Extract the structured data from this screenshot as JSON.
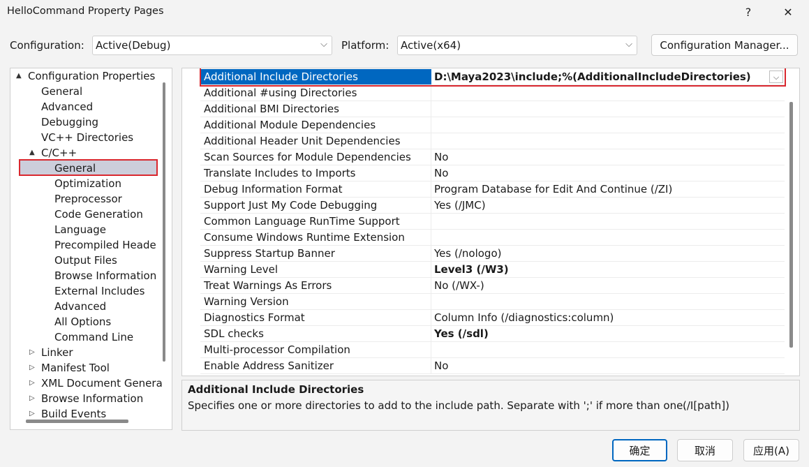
{
  "window": {
    "title": "HelloCommand Property Pages",
    "help_label": "?",
    "close_label": "✕"
  },
  "config_bar": {
    "configuration_label": "Configuration:",
    "configuration_value": "Active(Debug)",
    "platform_label": "Platform:",
    "platform_value": "Active(x64)",
    "config_manager_label": "Configuration Manager..."
  },
  "tree": {
    "items": [
      {
        "label": "Configuration Properties",
        "arrow": "▲"
      },
      {
        "label": "General"
      },
      {
        "label": "Advanced"
      },
      {
        "label": "Debugging"
      },
      {
        "label": "VC++ Directories"
      },
      {
        "label": "C/C++",
        "arrow": "▲"
      },
      {
        "label": "General",
        "selected": true
      },
      {
        "label": "Optimization"
      },
      {
        "label": "Preprocessor"
      },
      {
        "label": "Code Generation"
      },
      {
        "label": "Language"
      },
      {
        "label": "Precompiled Heade"
      },
      {
        "label": "Output Files"
      },
      {
        "label": "Browse Information"
      },
      {
        "label": "External Includes"
      },
      {
        "label": "Advanced"
      },
      {
        "label": "All Options"
      },
      {
        "label": "Command Line"
      },
      {
        "label": "Linker",
        "arrow": "▷"
      },
      {
        "label": "Manifest Tool",
        "arrow": "▷"
      },
      {
        "label": "XML Document Genera",
        "arrow": "▷"
      },
      {
        "label": "Browse Information",
        "arrow": "▷"
      },
      {
        "label": "Build Events",
        "arrow": "▷"
      }
    ]
  },
  "grid": {
    "rows": [
      {
        "name": "Additional Include Directories",
        "value": "D:\\Maya2023\\include;%(AdditionalIncludeDirectories)"
      },
      {
        "name": "Additional #using Directories",
        "value": ""
      },
      {
        "name": "Additional BMI Directories",
        "value": ""
      },
      {
        "name": "Additional Module Dependencies",
        "value": ""
      },
      {
        "name": "Additional Header Unit Dependencies",
        "value": ""
      },
      {
        "name": "Scan Sources for Module Dependencies",
        "value": "No"
      },
      {
        "name": "Translate Includes to Imports",
        "value": "No"
      },
      {
        "name": "Debug Information Format",
        "value": "Program Database for Edit And Continue (/ZI)"
      },
      {
        "name": "Support Just My Code Debugging",
        "value": "Yes (/JMC)"
      },
      {
        "name": "Common Language RunTime Support",
        "value": ""
      },
      {
        "name": "Consume Windows Runtime Extension",
        "value": ""
      },
      {
        "name": "Suppress Startup Banner",
        "value": "Yes (/nologo)"
      },
      {
        "name": "Warning Level",
        "value": "Level3 (/W3)",
        "bold": true
      },
      {
        "name": "Treat Warnings As Errors",
        "value": "No (/WX-)"
      },
      {
        "name": "Warning Version",
        "value": ""
      },
      {
        "name": "Diagnostics Format",
        "value": "Column Info (/diagnostics:column)"
      },
      {
        "name": "SDL checks",
        "value": "Yes (/sdl)",
        "bold": true
      },
      {
        "name": "Multi-processor Compilation",
        "value": ""
      },
      {
        "name": "Enable Address Sanitizer",
        "value": "No"
      }
    ]
  },
  "description": {
    "title": "Additional Include Directories",
    "text": "Specifies one or more directories to add to the include path. Separate with ';' if more than one.",
    "switch": "(/I[path])"
  },
  "buttons": {
    "ok": "确定",
    "cancel": "取消",
    "apply": "应用(A)"
  },
  "colors": {
    "selection_blue": "#0067c0",
    "tree_selection": "#cccedb",
    "highlight_red": "#d9272e",
    "ok_border": "#0067c0"
  }
}
